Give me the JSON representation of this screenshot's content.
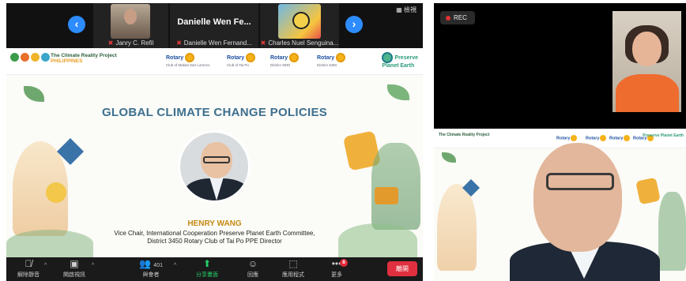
{
  "zoom": {
    "gallery": [
      {
        "name": "Janry C. Refil"
      },
      {
        "name": "Danielle Wen Fernand..."
      },
      {
        "name": "Charles Nuel Senguina..."
      }
    ],
    "center_display_name": "Danielle Wen Fe...",
    "view_label": "檢視",
    "slide": {
      "org_name": "The Climate Reality Project",
      "org_sub": "PHILIPPINES",
      "rotary_clubs": [
        {
          "label": "Rotary",
          "club": "Club of Makati San Lorenzo"
        },
        {
          "label": "Rotary",
          "club": "Club of Tai Po"
        },
        {
          "label": "Rotary",
          "club": "District 3830"
        },
        {
          "label": "Rotary",
          "club": "District 3450"
        }
      ],
      "ppe_line1": "Preserve",
      "ppe_line2": "Planet Earth",
      "title": "GLOBAL CLIMATE CHANGE POLICIES",
      "speaker_name": "HENRY WANG",
      "speaker_desc_1": "Vice Chair, International Cooperation Preserve Planet Earth Committee,",
      "speaker_desc_2": "District 3450 Rotary Club of Tai Po PPE Director"
    },
    "toolbar": {
      "mute": "解除靜音",
      "video": "開啟視訊",
      "participants_count": "401",
      "participants": "與會者",
      "share": "分享畫面",
      "reactions": "回應",
      "apps": "應用程式",
      "more": "更多",
      "more_badge": "8",
      "leave": "離開"
    }
  },
  "recording": {
    "rec_label": "REC",
    "mini_org": "The Climate Reality Project",
    "mini_rotary": [
      "Rotary",
      "Rotary",
      "Rotary",
      "Rotary"
    ],
    "mini_ppe": "Preserve Planet Earth"
  },
  "colors": {
    "zoom_blue": "#2d8cff",
    "leave_red": "#e0303f",
    "title_blue": "#3d6f8f",
    "speaker_gold": "#c58a12",
    "share_green": "#24d16a"
  }
}
